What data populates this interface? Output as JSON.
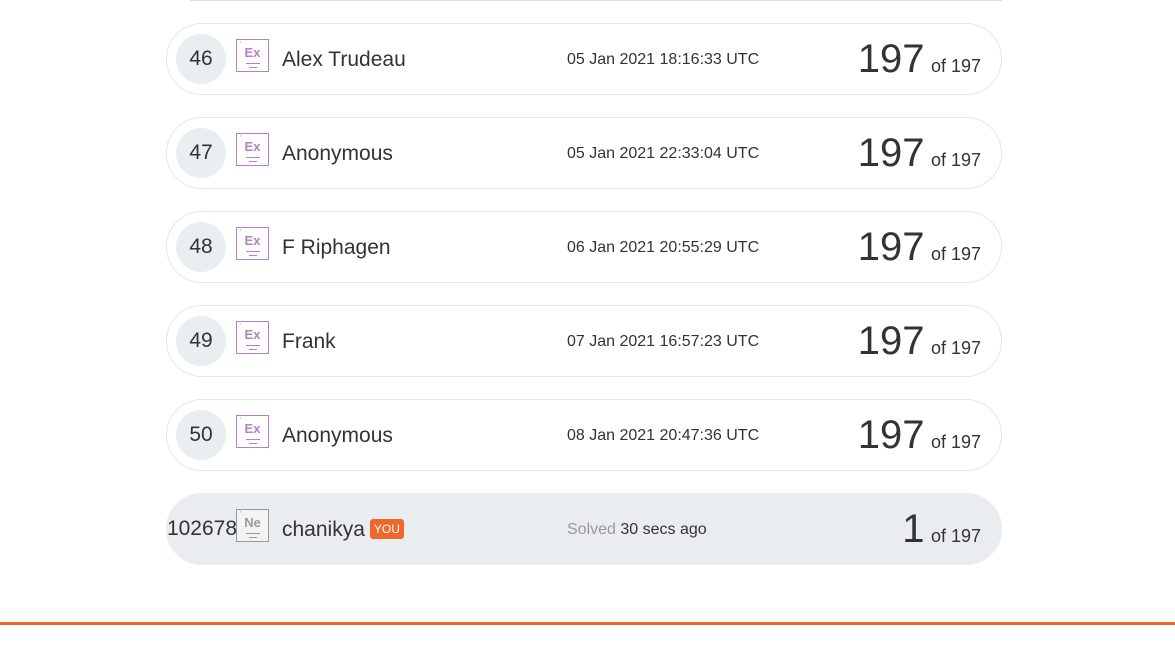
{
  "rows": [
    {
      "rank": "46",
      "badge": "Ex",
      "name": "Alex Trudeau",
      "time": "05 Jan 2021 18:16:33 UTC",
      "score": "197",
      "of": "of 197"
    },
    {
      "rank": "47",
      "badge": "Ex",
      "name": "Anonymous",
      "time": "05 Jan 2021 22:33:04 UTC",
      "score": "197",
      "of": "of 197"
    },
    {
      "rank": "48",
      "badge": "Ex",
      "name": "F Riphagen",
      "time": "06 Jan 2021 20:55:29 UTC",
      "score": "197",
      "of": "of 197"
    },
    {
      "rank": "49",
      "badge": "Ex",
      "name": "Frank",
      "time": "07 Jan 2021 16:57:23 UTC",
      "score": "197",
      "of": "of 197"
    },
    {
      "rank": "50",
      "badge": "Ex",
      "name": "Anonymous",
      "time": "08 Jan 2021 20:47:36 UTC",
      "score": "197",
      "of": "of 197"
    }
  ],
  "you_row": {
    "rank": "102678",
    "badge": "Ne",
    "name": "chanikya",
    "you_tag": "YOU",
    "solved_label": "Solved",
    "time": "30 secs ago",
    "score": "1",
    "of": "of 197"
  },
  "badge_icons": {
    "expert": "element-ex-icon",
    "newbie": "element-ne-icon"
  },
  "colors": {
    "accent": "#f0672e",
    "badge_purple": "#b77fc5",
    "badge_grey": "#9a9a9a",
    "you_row_bg": "#e9edf0"
  }
}
